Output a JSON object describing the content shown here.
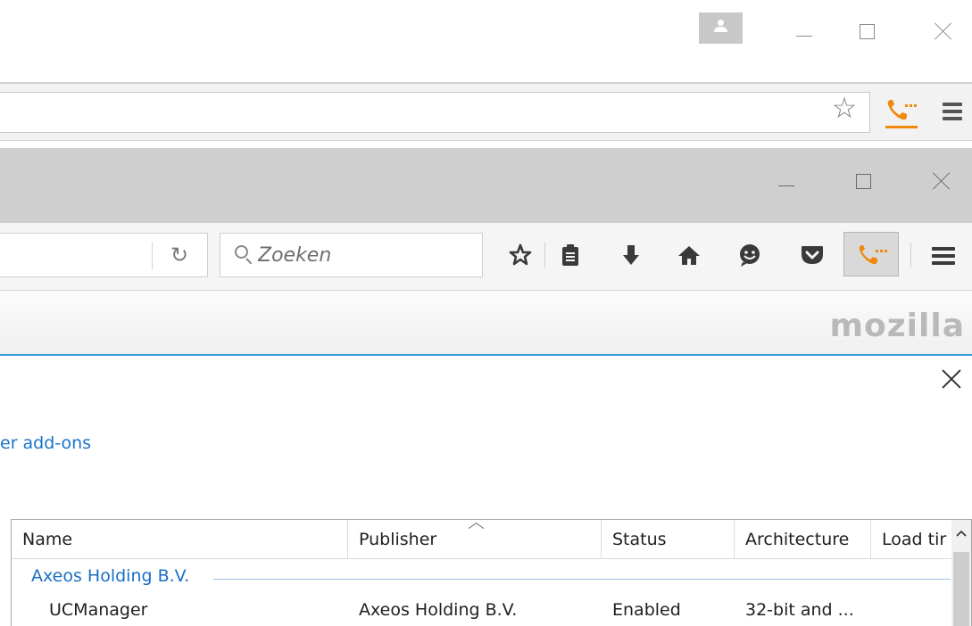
{
  "search": {
    "placeholder": "Zoeken"
  },
  "brand": {
    "logo_text": "mozilla"
  },
  "dialog": {
    "link_text": "er add-ons"
  },
  "addons_table": {
    "columns": [
      "Name",
      "Publisher",
      "Status",
      "Architecture",
      "Load tir"
    ],
    "groups": [
      {
        "label": "Axeos Holding B.V.",
        "rows": [
          {
            "name": "UCManager",
            "publisher": "Axeos Holding B.V.",
            "status": "Enabled",
            "architecture": "32-bit and ..."
          }
        ]
      }
    ]
  },
  "icons": {
    "profile": "user-icon",
    "bookmark": "star-icon",
    "reading_list": "clipboard-icon",
    "downloads": "download-arrow-icon",
    "home": "home-icon",
    "hello": "smiley-icon",
    "pocket": "pocket-icon",
    "phone_addon": "phone-icon",
    "menu": "hamburger-icon"
  },
  "colors": {
    "accent_blue": "#3a9ad9",
    "link_blue": "#1a73c9",
    "addon_orange": "#f0890d"
  }
}
